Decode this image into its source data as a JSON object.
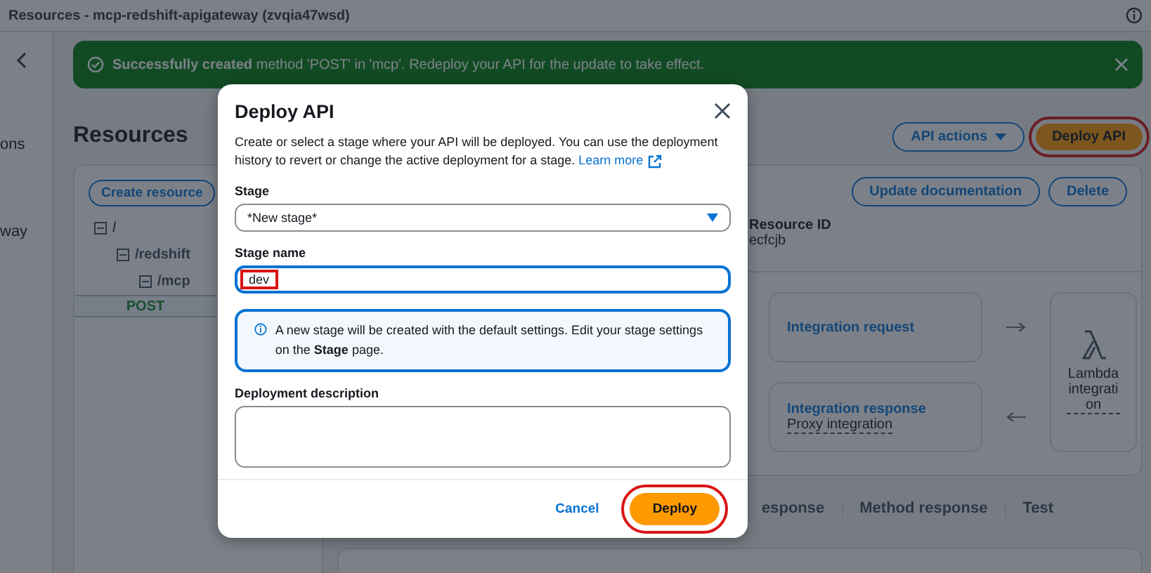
{
  "window": {
    "title": "Resources - mcp-redshift-apigateway (zvqia47wsd)"
  },
  "sidebar": {
    "items": [
      "ons",
      "way"
    ]
  },
  "flash": {
    "kind": "success",
    "message": "**Successfully created** method 'POST' in 'mcp'. Redeploy your API for the update to take effect."
  },
  "page": {
    "title": "Resources",
    "actions": [
      {
        "label": "API actions",
        "kind": "dropdown",
        "highlighted": false
      },
      {
        "label": "Deploy API",
        "kind": "primary",
        "highlighted": true
      }
    ]
  },
  "resource_tree": {
    "button": "Create resource",
    "items": [
      {
        "label": "/",
        "expanded": true,
        "children": [
          {
            "label": "/redshift",
            "expanded": true,
            "children": [
              {
                "label": "/mcp",
                "expanded": true,
                "children": [
                  {
                    "label": "POST",
                    "selected": true
                  }
                ]
              }
            ]
          }
        ]
      }
    ]
  },
  "resource_details": {
    "buttons": [
      "Update documentation",
      "Delete"
    ],
    "resource_id_label": "Resource ID",
    "resource_id": "ecfcjb"
  },
  "flow": {
    "integration_request": "Integration request",
    "integration_response": "Integration response",
    "integration_response_detail": "Proxy integration",
    "target": "Lambda integration"
  },
  "method_tabs": [
    {
      "label": "esponse",
      "selected": false
    },
    {
      "label": "Method response",
      "selected": false
    },
    {
      "label": "Test",
      "selected": false
    }
  ],
  "modal": {
    "title": "Deploy API",
    "description": "Create or select a stage where your API will be deployed. You can use the deployment history to revert or change the active deployment for a stage.",
    "learn_more": "Learn more",
    "fields": [
      {
        "kind": "select",
        "label": "Stage",
        "value": "*New stage*"
      },
      {
        "kind": "text",
        "label": "Stage name",
        "value": "dev",
        "highlighted": true
      },
      {
        "kind": "info",
        "text": "A new stage will be created with the default settings. Edit your stage settings on the **Stage** page."
      },
      {
        "kind": "textarea",
        "label": "Deployment description"
      }
    ],
    "buttons": [
      {
        "label": "Cancel",
        "kind": "link",
        "highlighted": false
      },
      {
        "label": "Deploy",
        "kind": "primary",
        "highlighted": true
      }
    ]
  }
}
